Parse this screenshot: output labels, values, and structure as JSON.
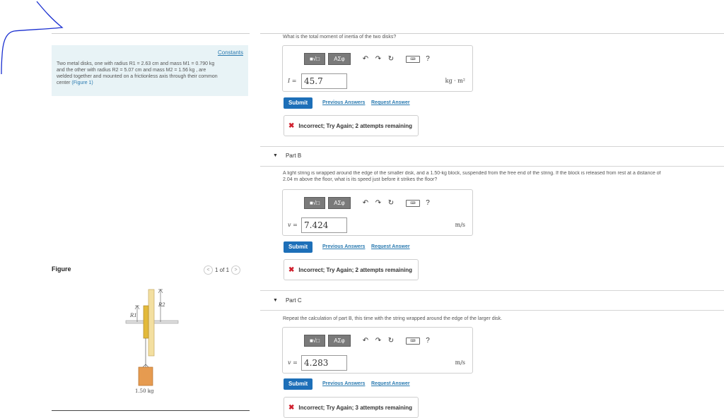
{
  "problem": {
    "constants_link": "Constants",
    "line1": "Two metal disks, one with radius R1 = 2.63 cm and mass M1 = 0.790 kg",
    "line2": "and the other with radius R2 = 5.07 cm and mass M2 = 1.56 kg , are",
    "line3": "welded together and mounted on a frictionless axis through their common",
    "line4_prefix": "center",
    "figure_link": "(Figure 1)"
  },
  "figure": {
    "label": "Figure",
    "pager_text": "1 of 1",
    "prev_icon": "chevron-left-icon",
    "next_icon": "chevron-right-icon",
    "r1_label": "R1",
    "r2_label": "R2",
    "mass_label": "1.50 kg"
  },
  "toolbar": {
    "template_btn": "■√□",
    "greek_btn": "ΑΣφ",
    "undo_icon": "undo-icon",
    "redo_icon": "redo-icon",
    "reset_icon": "reset-icon",
    "keyboard_icon": "keyboard-icon",
    "keyboard_label": "⌨",
    "help_label": "?"
  },
  "partA": {
    "question": "What is the total moment of inertia of the two disks?",
    "var_label": "I =",
    "answer_value": "45.7",
    "unit": "kg · m²",
    "submit": "Submit",
    "previous_answers": "Previous Answers",
    "request_answer": "Request Answer",
    "feedback": "Incorrect; Try Again; 2 attempts remaining"
  },
  "partB": {
    "title": "Part B",
    "question_line1": "A light string is wrapped around the edge of the smaller disk, and a 1.50-kg block, suspended from the free end of the string. If the block is released from rest at a distance of",
    "question_line2": "2.04 m above the floor, what is its speed just before it strikes the floor?",
    "var_label": "v =",
    "answer_value": "7.424",
    "unit": "m/s",
    "submit": "Submit",
    "previous_answers": "Previous Answers",
    "request_answer": "Request Answer",
    "feedback": "Incorrect; Try Again; 2 attempts remaining"
  },
  "partC": {
    "title": "Part C",
    "question": "Repeat the calculation of part B, this time with the string wrapped around the edge of the larger disk.",
    "var_label": "v =",
    "answer_value": "4.283",
    "unit": "m/s",
    "submit": "Submit",
    "previous_answers": "Previous Answers",
    "request_answer": "Request Answer",
    "feedback": "Incorrect; Try Again; 3 attempts remaining"
  },
  "colors": {
    "accent": "#1d6fb8",
    "error": "#d0202e",
    "constants_bg": "#e8f3f6",
    "annotation_ink": "#1a2fd0"
  }
}
